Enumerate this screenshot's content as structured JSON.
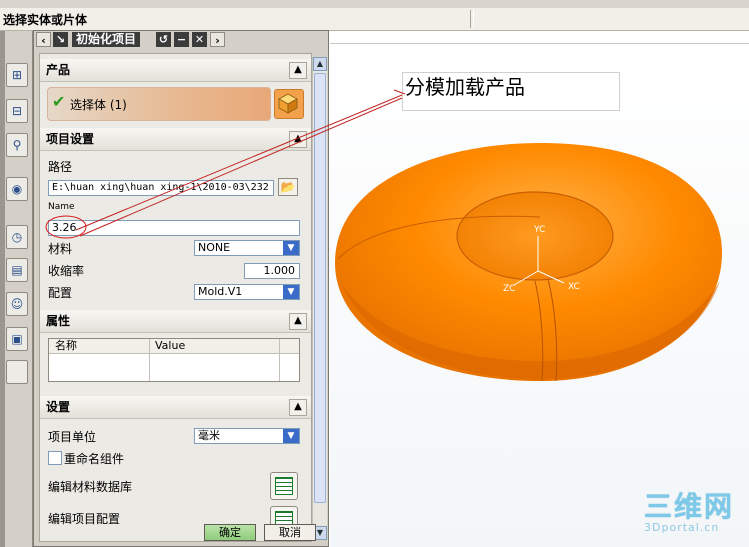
{
  "statusbar": {
    "prompt": "选择实体或片体"
  },
  "dialog": {
    "title": "初始化项目",
    "sections": {
      "product": "产品",
      "project_settings": "项目设置",
      "attributes": "属性",
      "settings": "设置"
    },
    "product": {
      "select_label": "选择体 (1)"
    },
    "path_label": "路径",
    "path_value": "E:\\huan xing\\huan xing-1\\2010-03\\232",
    "name_label": "Name",
    "name_value": "3.26",
    "material_label": "材料",
    "material_value": "NONE",
    "shrink_label": "收缩率",
    "shrink_value": "1.000",
    "config_label": "配置",
    "config_value": "Mold.V1",
    "attr_table": {
      "col_name": "名称",
      "col_value": "Value"
    },
    "units_label": "项目单位",
    "units_value": "毫米",
    "rename_label": "重命名组件",
    "edit_material_db": "编辑材料数据库",
    "edit_project_config": "编辑项目配置",
    "ok": "确定",
    "cancel": "取消"
  },
  "callout_text": "分模加载产品",
  "axes": {
    "x": "XC",
    "y": "YC",
    "z": "ZC"
  },
  "watermark": {
    "big": "三维网",
    "small": "3Dportal.cn"
  },
  "colors": {
    "part_orange": "#ff8a00",
    "ok_green": "#9fd88a",
    "accent_blue": "#3b6bc8"
  },
  "icons": [
    "back-arrow-icon",
    "forward-arrow-icon",
    "reset-icon",
    "minimize-icon",
    "close-icon",
    "checkmark-icon",
    "cube-icon",
    "folder-icon",
    "dropdown-arrow-icon",
    "collapse-icon",
    "table-icon"
  ]
}
